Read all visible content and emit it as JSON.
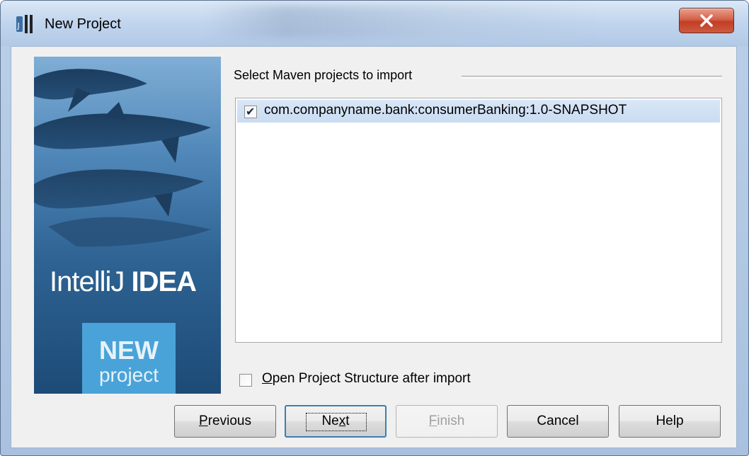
{
  "window": {
    "title": "New Project",
    "close_symbol": "✕",
    "accent_close": "#c23e25"
  },
  "banner": {
    "brand_light": "IntelliJ ",
    "brand_bold": "IDEA",
    "badge_line1": "NEW",
    "badge_line2": "project"
  },
  "import_group": {
    "title": "Select Maven projects to import",
    "projects": [
      {
        "label": "com.companyname.bank:consumerBanking:1.0-SNAPSHOT",
        "checked": true
      }
    ]
  },
  "option": {
    "mnemonic": "O",
    "rest": "pen Project Structure after import",
    "checked": false
  },
  "buttons": {
    "previous": {
      "mn": "P",
      "rest": "revious"
    },
    "next": {
      "pre": "Ne",
      "mn": "x",
      "rest": "t"
    },
    "finish": {
      "mn": "F",
      "rest": "inish"
    },
    "cancel": "Cancel",
    "help": "Help"
  }
}
